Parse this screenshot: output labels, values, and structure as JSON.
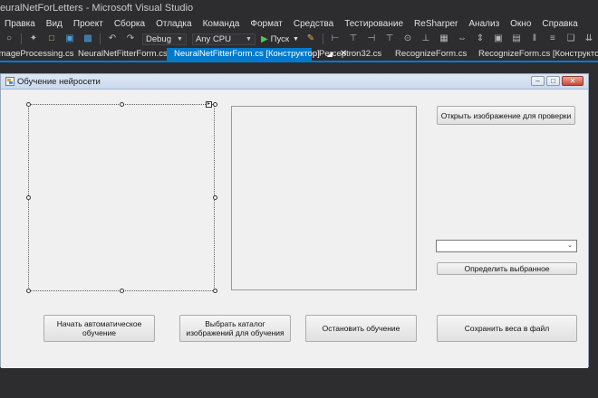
{
  "window": {
    "title": "NeuralNetForLetters - Microsoft Visual Studio"
  },
  "menu": {
    "items": [
      "Правка",
      "Вид",
      "Проект",
      "Сборка",
      "Отладка",
      "Команда",
      "Формат",
      "Средства",
      "Тестирование",
      "ReSharper",
      "Анализ",
      "Окно",
      "Справка"
    ]
  },
  "toolbar": {
    "config": "Debug",
    "platform": "Any CPU",
    "run_label": "Пуск"
  },
  "tabs": [
    {
      "label": "ImageProcessing.cs"
    },
    {
      "label": "NeuralNetFitterForm.cs"
    },
    {
      "label": "NeuralNetFitterForm.cs [Конструктор]",
      "active": true
    },
    {
      "label": "Perceptron32.cs"
    },
    {
      "label": "RecognizeForm.cs"
    },
    {
      "label": "RecognizeForm.cs [Конструктор]"
    }
  ],
  "form": {
    "title": "Обучение нейросети",
    "buttons": {
      "open_image": "Открыть изображение для проверки",
      "detect_selected": "Определить выбранное",
      "start_auto": "Начать автоматическое обучение",
      "choose_dir": "Выбрать каталог изображений для обучения",
      "stop": "Остановить обучение",
      "save_weights": "Сохранить веса в файл"
    },
    "combo_value": ""
  }
}
